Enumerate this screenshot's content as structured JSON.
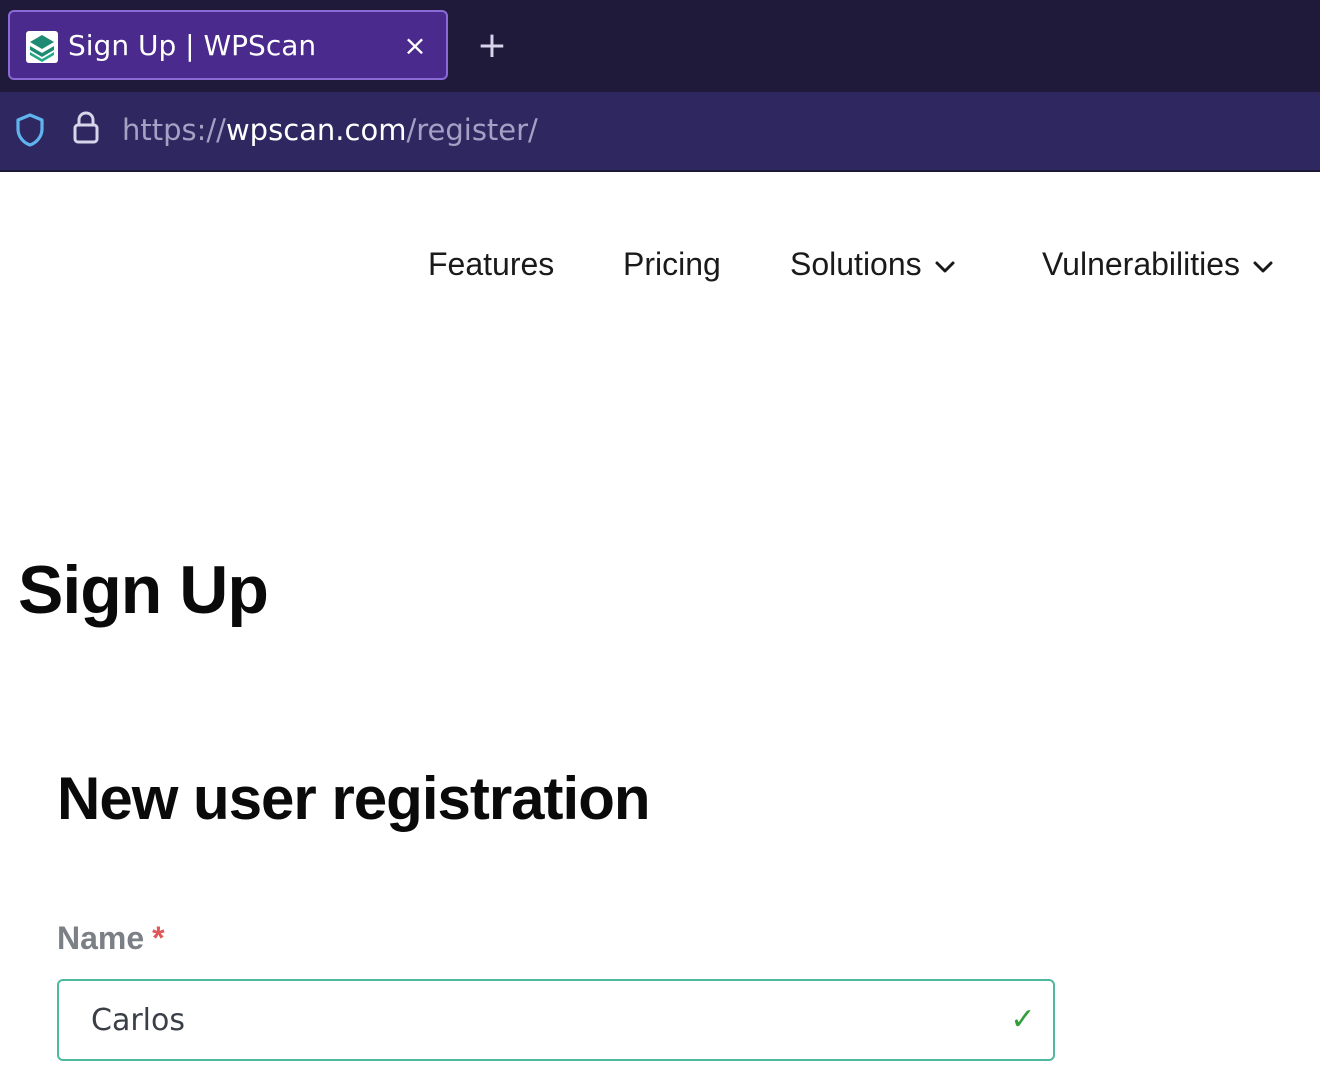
{
  "browser": {
    "tab": {
      "title": "Sign Up | WPScan",
      "close_glyph": "×",
      "favicon": "wpscan-logo-icon"
    },
    "new_tab_glyph": "+",
    "url": {
      "scheme": "https://",
      "host": "wpscan.com",
      "path": "/register/"
    }
  },
  "nav": {
    "items": [
      {
        "label": "Features",
        "has_dropdown": false
      },
      {
        "label": "Pricing",
        "has_dropdown": false
      },
      {
        "label": "Solutions",
        "has_dropdown": true
      },
      {
        "label": "Vulnerabilities",
        "has_dropdown": true
      }
    ]
  },
  "page": {
    "title": "Sign Up",
    "form": {
      "heading": "New user registration",
      "fields": [
        {
          "label": "Name",
          "required_mark": "*",
          "value": "Carlos",
          "valid_glyph": "✓"
        }
      ]
    }
  },
  "colors": {
    "tabbar_bg": "#1f1a3a",
    "tab_active_bg": "#4a2a8c",
    "urlbar_bg": "#2e2760",
    "input_border_valid": "#4fb9a0",
    "required": "#e0575b",
    "valid_check": "#2e9e3a"
  }
}
